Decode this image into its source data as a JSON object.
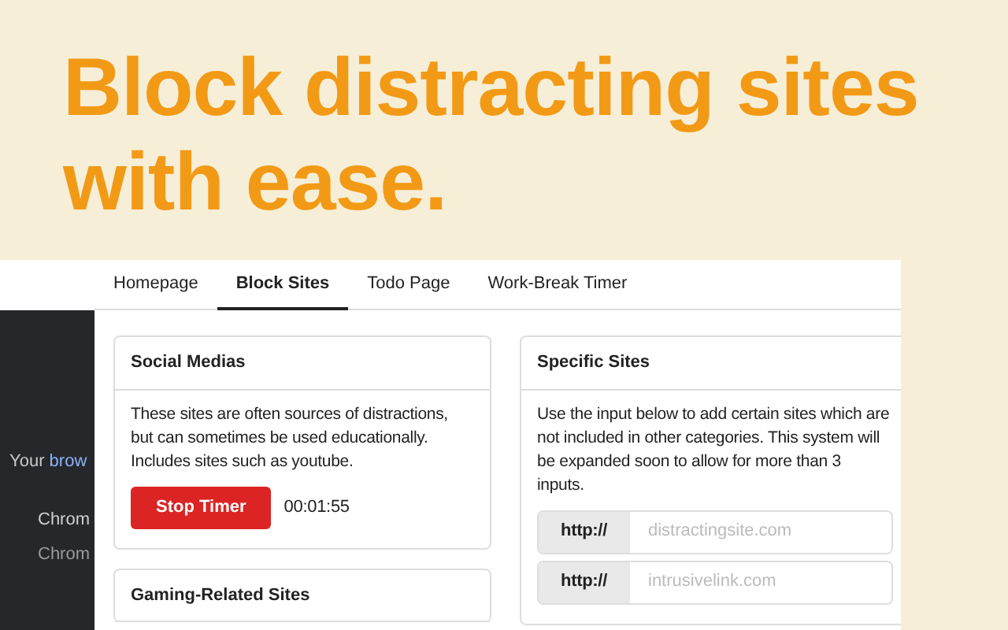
{
  "headline": "Block distracting sites with ease.",
  "background_window": {
    "notice_text": "Your ",
    "notice_link": "brow",
    "items": [
      {
        "title": "Chrom",
        "subtitle": "Chrom"
      }
    ]
  },
  "tabs": [
    {
      "label": "Homepage",
      "selected": false
    },
    {
      "label": "Block Sites",
      "selected": true
    },
    {
      "label": "Todo Page",
      "selected": false
    },
    {
      "label": "Work-Break Timer",
      "selected": false
    }
  ],
  "columns": [
    {
      "cards": [
        {
          "kind": "timer",
          "title": "Social Medias",
          "text": "These sites are often sources of distractions, but can sometimes be used educationally. Includes sites such as youtube.",
          "button": "Stop Timer",
          "time": "00:01:55"
        },
        {
          "kind": "header",
          "title": "Gaming-Related Sites"
        }
      ]
    },
    {
      "cards": [
        {
          "kind": "inputs",
          "title": "Specific Sites",
          "text": "Use the input below to add certain sites which are not included in other categories. This system will be expanded soon to allow for more than 3 inputs.",
          "inputs": [
            {
              "prefix": "http://",
              "placeholder": "distractingsite.com"
            },
            {
              "prefix": "http://",
              "placeholder": "intrusivelink.com"
            }
          ]
        }
      ]
    }
  ]
}
